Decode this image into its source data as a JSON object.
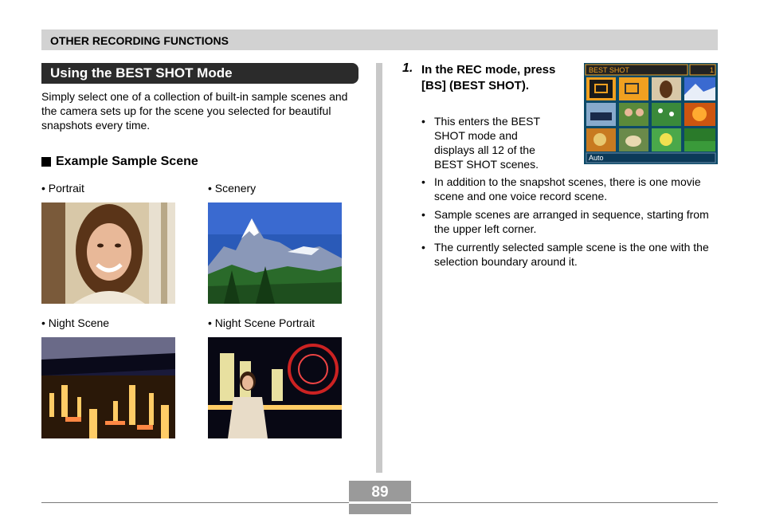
{
  "header": {
    "title": "OTHER RECORDING FUNCTIONS"
  },
  "section": {
    "title": "Using the BEST SHOT Mode"
  },
  "intro": "Simply select one of a collection of built-in sample scenes and the camera sets up for the scene you selected for beautiful snapshots every time.",
  "example": {
    "heading": "Example Sample Scene",
    "items": [
      {
        "label": "• Portrait"
      },
      {
        "label": "• Scenery"
      },
      {
        "label": "• Night Scene"
      },
      {
        "label": "• Night Scene Portrait"
      }
    ]
  },
  "step": {
    "number": "1.",
    "text": "In the REC mode, press [BS] (BEST SHOT).",
    "bullets": [
      "This enters the BEST SHOT mode and displays all 12 of the BEST SHOT scenes.",
      "In addition to the snapshot scenes, there is one movie scene and one voice record scene.",
      "Sample scenes are arranged in sequence, starting from the upper left corner.",
      "The currently selected sample scene is the one with the selection boundary around it."
    ]
  },
  "lcd": {
    "title": "BEST SHOT",
    "counter": "1",
    "mode": "Auto"
  },
  "footer": {
    "page_number": "89"
  },
  "colors": {
    "header_bg": "#d2d2d2",
    "title_bg": "#2b2b2b",
    "divider": "#c8c8c8",
    "lcd_accent": "#f0a020"
  }
}
